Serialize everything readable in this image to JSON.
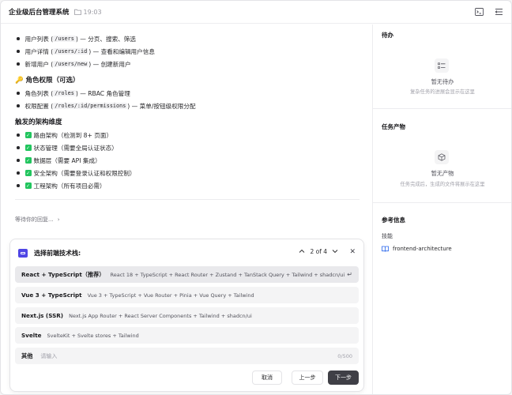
{
  "header": {
    "title": "企业级后台管理系统",
    "time": "19:03"
  },
  "message": {
    "user_items": [
      {
        "prefix": "用户列表 (",
        "code": "/users",
        "suffix": ") — 分页、搜索、筛选"
      },
      {
        "prefix": "用户详情 (",
        "code": "/users/:id",
        "suffix": ") — 查看和编辑用户信息"
      },
      {
        "prefix": "新增用户 (",
        "code": "/users/new",
        "suffix": ") — 创建新用户"
      }
    ],
    "role_heading": "🔑 角色权限（可选）",
    "role_items": [
      {
        "prefix": "角色列表 (",
        "code": "/roles",
        "suffix": ") — RBAC 角色管理"
      },
      {
        "prefix": "权限配置 (",
        "code": "/roles/:id/permissions",
        "suffix": ") — 菜单/按钮级权限分配"
      }
    ],
    "arch_heading": "触发的架构维度",
    "arch_items": [
      "路由架构（检测到 8+ 页面）",
      "状态管理（需要全局认证状态）",
      "数据层（需要 API 集成）",
      "安全架构（需要登录认证和权限控制）",
      "工程架构（所有项目必需）"
    ],
    "waiting": "等待你的回复..."
  },
  "question": {
    "title": "选择前端技术栈:",
    "pager": "2 of 4",
    "options": [
      {
        "name": "React + TypeScript（推荐）",
        "desc": "React 18 + TypeScript + React Router + Zustand + TanStack Query + Tailwind + shadcn/ui"
      },
      {
        "name": "Vue 3 + TypeScript",
        "desc": "Vue 3 + TypeScript + Vue Router + Pinia + Vue Query + Tailwind"
      },
      {
        "name": "Next.js (SSR)",
        "desc": "Next.js App Router + React Server Components + Tailwind + shadcn/ui"
      },
      {
        "name": "Svelte",
        "desc": "SvelteKit + Svelte stores + Tailwind"
      }
    ],
    "other_label": "其他",
    "other_placeholder": "请输入",
    "other_counter": "0/500",
    "buttons": {
      "cancel": "取消",
      "prev": "上一步",
      "next": "下一步"
    }
  },
  "sidebar": {
    "todo_title": "待办",
    "todo_empty": "暂无待办",
    "todo_empty_sub": "复杂任务的进展会显示在这里",
    "artifacts_title": "任务产物",
    "artifacts_empty": "暂无产物",
    "artifacts_empty_sub": "任务完成后，生成的文件将展示在这里",
    "ref_title": "参考信息",
    "skills_label": "技能",
    "skill_name": "frontend-architecture"
  },
  "colors": {
    "accent": "#4f46e5",
    "check": "#22c55e",
    "primary_button": "#3f3f46",
    "skill_icon": "#2563eb"
  }
}
